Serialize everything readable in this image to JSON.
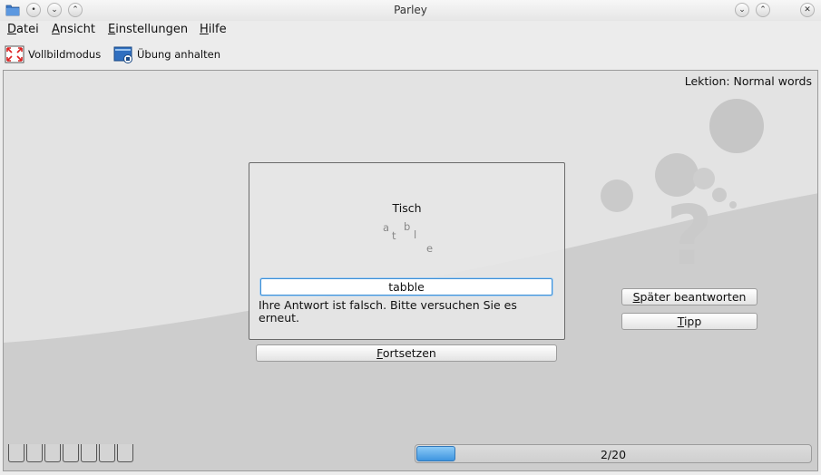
{
  "window": {
    "title": "Parley"
  },
  "menu": [
    {
      "label": "Datei",
      "accel": "D",
      "rest": "atei"
    },
    {
      "label": "Ansicht",
      "accel": "A",
      "rest": "nsicht"
    },
    {
      "label": "Einstellungen",
      "accel": "E",
      "rest": "instellungen"
    },
    {
      "label": "Hilfe",
      "accel": "H",
      "rest": "ilfe"
    }
  ],
  "toolbar": {
    "fullscreen_label": "Vollbildmodus",
    "pause_label": "Übung anhalten"
  },
  "practice": {
    "lesson": "Lektion: Normal words",
    "question_word": "Tisch",
    "scrambled_letters": [
      "a",
      "b",
      "t",
      "l",
      "e"
    ],
    "answer_value": "tabble",
    "feedback": "Ihre Antwort ist falsch. Bitte versuchen Sie es erneut.",
    "continue": {
      "label": "Fortsetzen",
      "accel": "F",
      "rest": "ortsetzen"
    },
    "answer_later": {
      "label": "Später beantworten",
      "accel": "S",
      "rest": "päter beantworten"
    },
    "hint": {
      "label": "Tipp",
      "accel": "T",
      "rest": "ipp"
    }
  },
  "status": {
    "progress_text": "2/20",
    "progress_fraction": 0.1,
    "box_count": 7
  },
  "colors": {
    "accent": "#3e95e0",
    "stage_bg": "#cdcdcd"
  }
}
